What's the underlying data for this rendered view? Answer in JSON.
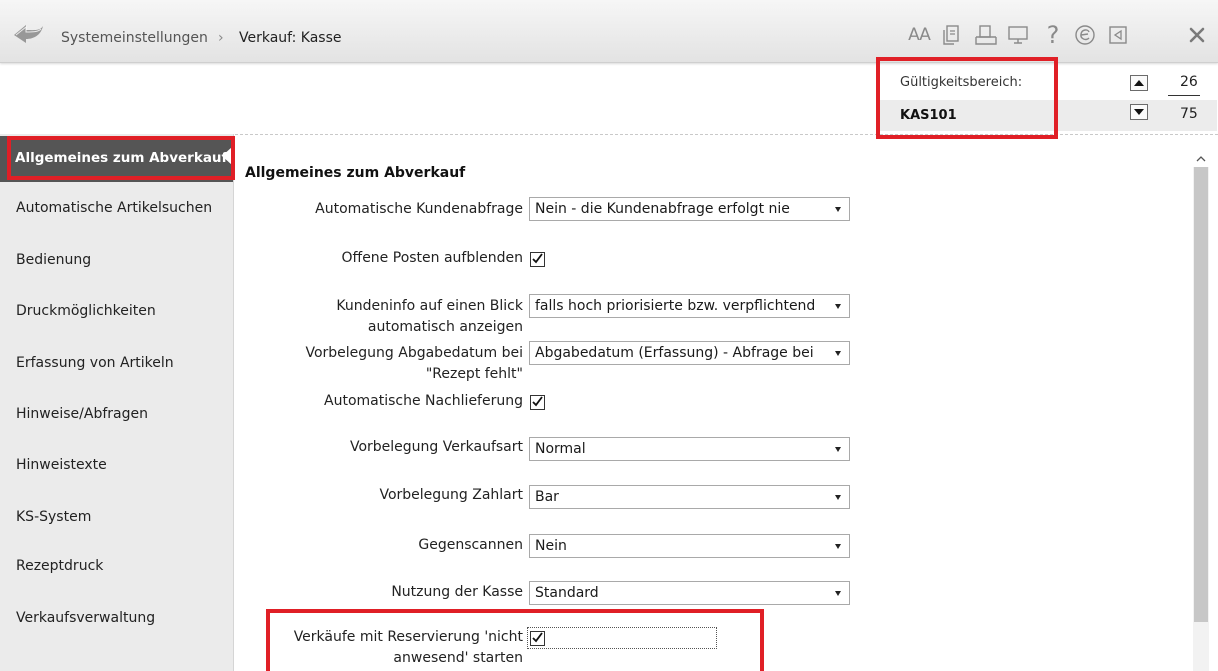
{
  "breadcrumb": {
    "root": "Systemeinstellungen",
    "separator": "›",
    "current": "Verkauf: Kasse"
  },
  "toolbar": {
    "icons": [
      "font-size-icon",
      "copy-document-icon",
      "print-icon",
      "monitor-icon",
      "help-icon",
      "edition-icon",
      "exit-window-icon",
      "close-icon"
    ],
    "font_size_label": "AA",
    "help_label": "?"
  },
  "scope": {
    "label": "Gültigkeitsbereich:",
    "value": "KAS101",
    "spin_up_value": "26",
    "spin_down_value": "75"
  },
  "sidebar": {
    "items": [
      {
        "label": "Allgemeines zum Abverkauf",
        "active": true
      },
      {
        "label": "Automatische Artikelsuchen"
      },
      {
        "label": "Bedienung"
      },
      {
        "label": "Druckmöglichkeiten"
      },
      {
        "label": "Erfassung von Artikeln"
      },
      {
        "label": "Hinweise/Abfragen"
      },
      {
        "label": "Hinweistexte"
      },
      {
        "label": "KS-System"
      },
      {
        "label": "Rezeptdruck"
      },
      {
        "label": "Verkaufsverwaltung"
      }
    ]
  },
  "main": {
    "title": "Allgemeines zum Abverkauf",
    "fields": {
      "kundenabfrage": {
        "label": "Automatische Kundenabfrage",
        "value": "Nein - die Kundenabfrage erfolgt nie"
      },
      "offene_posten": {
        "label": "Offene Posten aufblenden",
        "checked": true
      },
      "kundeninfo": {
        "label_line1": "Kundeninfo auf einen Blick",
        "label_line2": "automatisch anzeigen",
        "value": "falls hoch priorisierte bzw. verpflichtend"
      },
      "abgabedatum": {
        "label_line1": "Vorbelegung Abgabedatum bei",
        "label_line2": "\"Rezept fehlt\"",
        "value": "Abgabedatum (Erfassung) - Abfrage bei"
      },
      "nachlieferung": {
        "label": "Automatische Nachlieferung",
        "checked": true
      },
      "verkaufsart": {
        "label": "Vorbelegung Verkaufsart",
        "value": "Normal"
      },
      "zahlart": {
        "label": "Vorbelegung Zahlart",
        "value": "Bar"
      },
      "gegenscannen": {
        "label": "Gegenscannen",
        "value": "Nein"
      },
      "nutzung": {
        "label": "Nutzung der Kasse",
        "value": "Standard"
      },
      "reservierung": {
        "label_line1": "Verkäufe mit Reservierung 'nicht",
        "label_line2": "anwesend' starten",
        "checked": true
      }
    }
  },
  "colors": {
    "highlight_red": "#e01f26",
    "active_nav": "#555555",
    "sidebar_bg": "#ebebeb"
  }
}
